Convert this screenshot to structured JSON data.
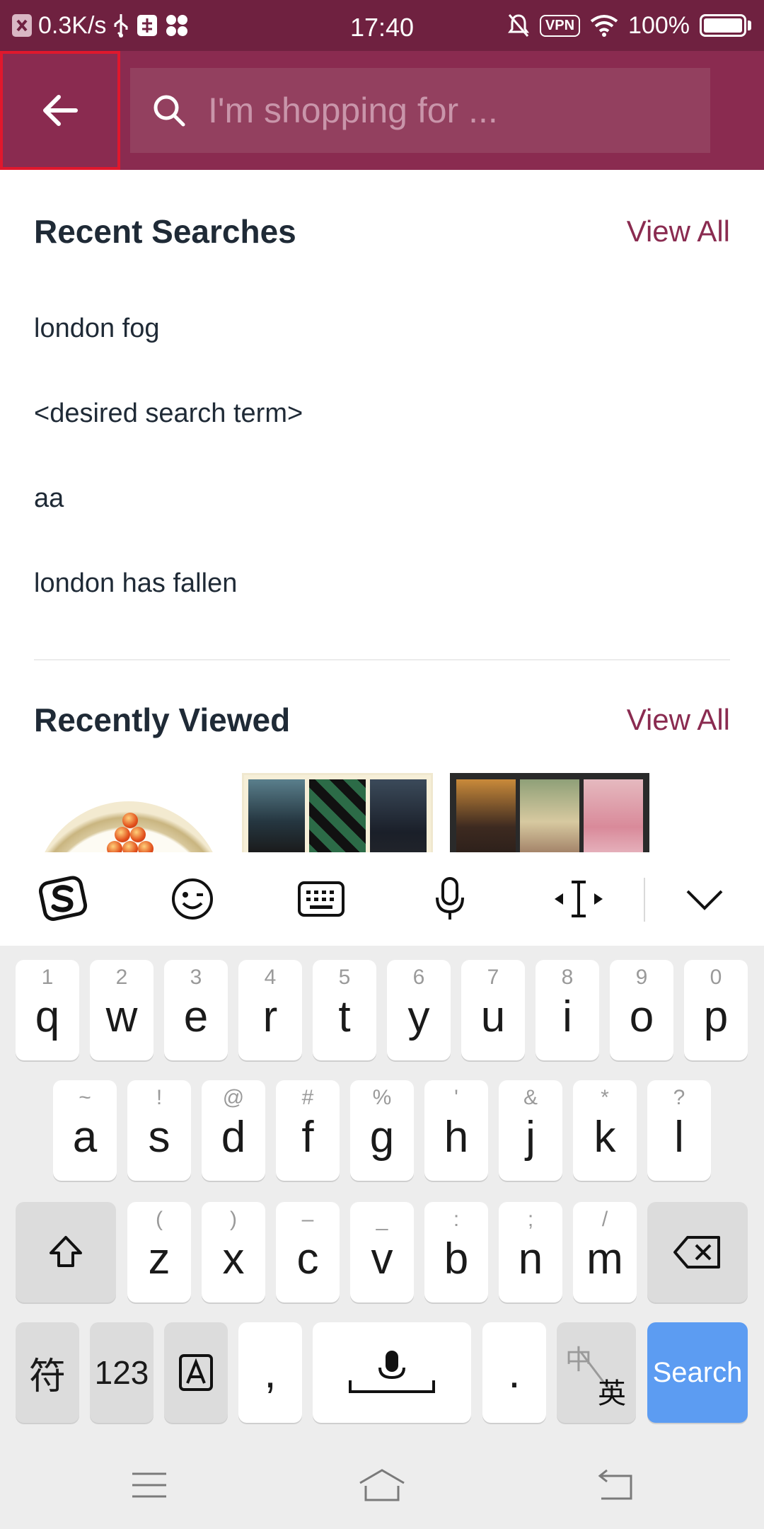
{
  "status_bar": {
    "net_speed": "0.3K/s",
    "time": "17:40",
    "vpn": "VPN",
    "battery": "100%"
  },
  "search": {
    "placeholder": "I'm shopping for ..."
  },
  "recent_searches": {
    "title": "Recent Searches",
    "view_all": "View All",
    "items": [
      "london fog",
      "<desired search term>",
      "aa",
      "london has fallen"
    ]
  },
  "recently_viewed": {
    "title": "Recently Viewed",
    "view_all": "View All"
  },
  "keyboard": {
    "row1": [
      {
        "hint": "1",
        "key": "q"
      },
      {
        "hint": "2",
        "key": "w"
      },
      {
        "hint": "3",
        "key": "e"
      },
      {
        "hint": "4",
        "key": "r"
      },
      {
        "hint": "5",
        "key": "t"
      },
      {
        "hint": "6",
        "key": "y"
      },
      {
        "hint": "7",
        "key": "u"
      },
      {
        "hint": "8",
        "key": "i"
      },
      {
        "hint": "9",
        "key": "o"
      },
      {
        "hint": "0",
        "key": "p"
      }
    ],
    "row2": [
      {
        "hint": "~",
        "key": "a"
      },
      {
        "hint": "!",
        "key": "s"
      },
      {
        "hint": "@",
        "key": "d"
      },
      {
        "hint": "#",
        "key": "f"
      },
      {
        "hint": "%",
        "key": "g"
      },
      {
        "hint": "'",
        "key": "h"
      },
      {
        "hint": "&",
        "key": "j"
      },
      {
        "hint": "*",
        "key": "k"
      },
      {
        "hint": "?",
        "key": "l"
      }
    ],
    "row3": [
      {
        "hint": "(",
        "key": "z"
      },
      {
        "hint": ")",
        "key": "x"
      },
      {
        "hint": "–",
        "key": "c"
      },
      {
        "hint": "_",
        "key": "v"
      },
      {
        "hint": ":",
        "key": "b"
      },
      {
        "hint": ";",
        "key": "n"
      },
      {
        "hint": "/",
        "key": "m"
      }
    ],
    "symbols_key": "符",
    "numbers_key": "123",
    "comma_key": ",",
    "period_key": ".",
    "lang_key_top": "中",
    "lang_key_bottom": "英",
    "search_key": "Search"
  },
  "colors": {
    "brand": "#8a2b50",
    "status_bar": "#6f2140",
    "search_key": "#5c9cf2"
  }
}
